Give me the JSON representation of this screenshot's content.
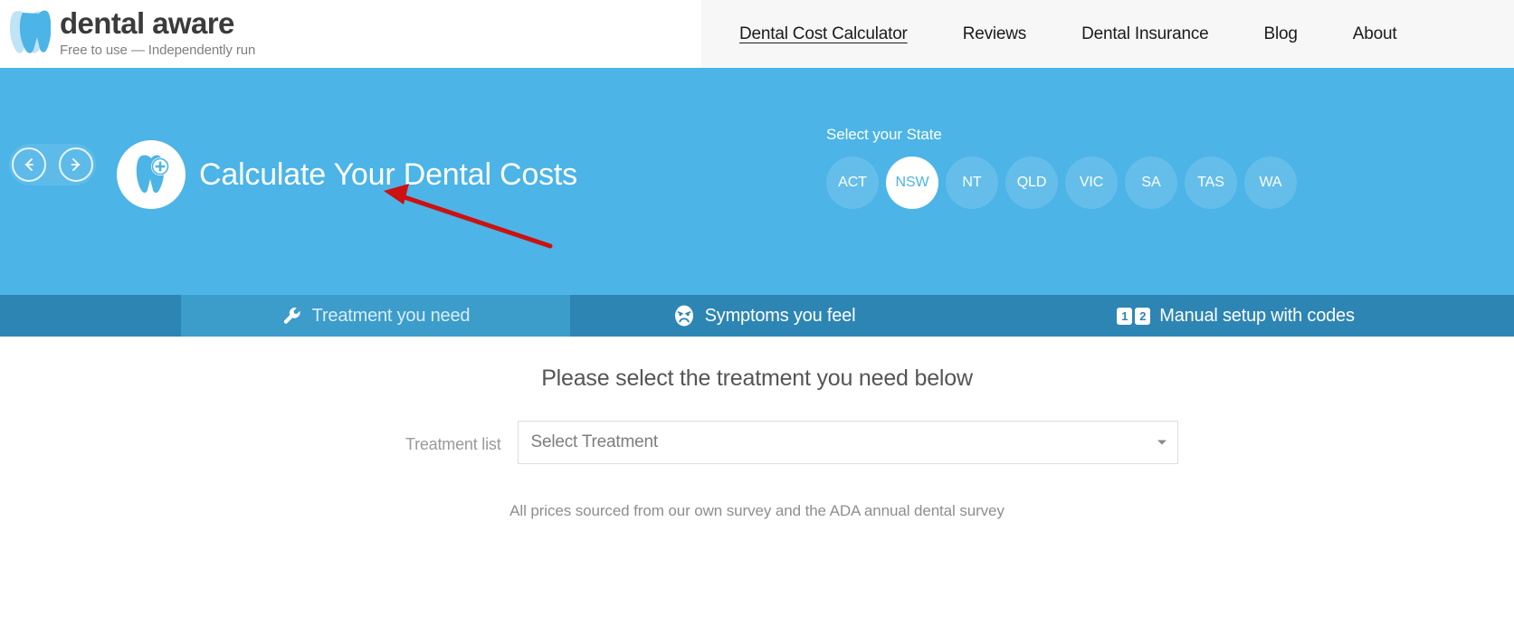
{
  "header": {
    "brand_name": "dental aware",
    "brand_tagline": "Free to use — Independently run",
    "logo_icon": "tooth-logo-icon",
    "nav": [
      {
        "label": "Dental Cost Calculator",
        "active": true
      },
      {
        "label": "Reviews",
        "active": false
      },
      {
        "label": "Dental Insurance",
        "active": false
      },
      {
        "label": "Blog",
        "active": false
      },
      {
        "label": "About",
        "active": false
      }
    ]
  },
  "hero": {
    "background_color": "#4cb4e7",
    "prev_icon": "arrow-left-circle-icon",
    "next_icon": "arrow-right-circle-icon",
    "badge_icon": "tooth-plus-icon",
    "title": "Calculate Your Dental Costs",
    "state_selector": {
      "label": "Select your State",
      "selected": "NSW",
      "options": [
        "ACT",
        "NSW",
        "NT",
        "QLD",
        "VIC",
        "SA",
        "TAS",
        "WA"
      ]
    }
  },
  "tabs": {
    "active_index": 0,
    "items": [
      {
        "label": "Treatment you need",
        "icon": "wrench-icon"
      },
      {
        "label": "Symptoms you feel",
        "icon": "sad-face-icon"
      },
      {
        "label": "Manual setup with codes",
        "icon": "number-codes-icon"
      }
    ],
    "code_icon_digits": [
      "1",
      "2"
    ]
  },
  "main": {
    "heading": "Please select the treatment you need below",
    "field_label": "Treatment list",
    "select_value": "Select Treatment",
    "select_placeholder": "Select Treatment",
    "caret_icon": "chevron-down-icon",
    "note": "All prices sourced from our own survey and the ADA annual dental survey"
  },
  "annotation": {
    "arrow_color": "#cc1111",
    "description": "red-pointer-arrow"
  }
}
